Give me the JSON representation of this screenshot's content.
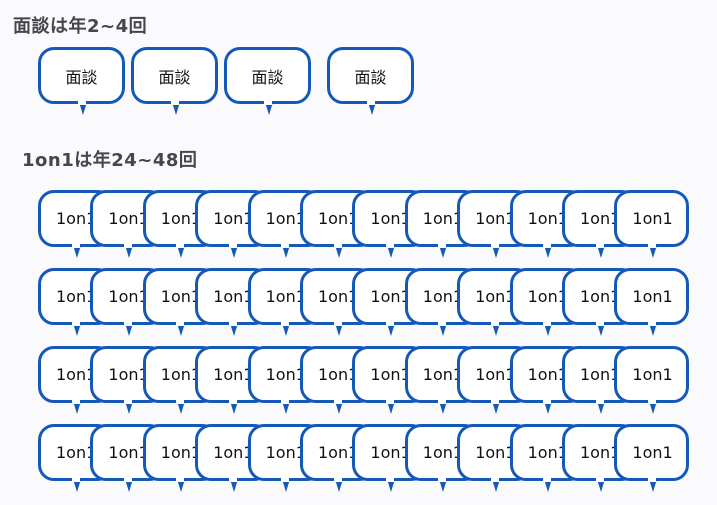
{
  "mendan": {
    "title": "面談は年2~4回",
    "bubble_label": "面談",
    "count": 4
  },
  "one_on_one": {
    "title": "1on1は年24~48回",
    "bubble_label": "1on1",
    "rows": 4,
    "per_row": 12
  },
  "colors": {
    "bubble_border": "#1559b8",
    "title_text": "#45474b",
    "background": "#faf9fb"
  }
}
